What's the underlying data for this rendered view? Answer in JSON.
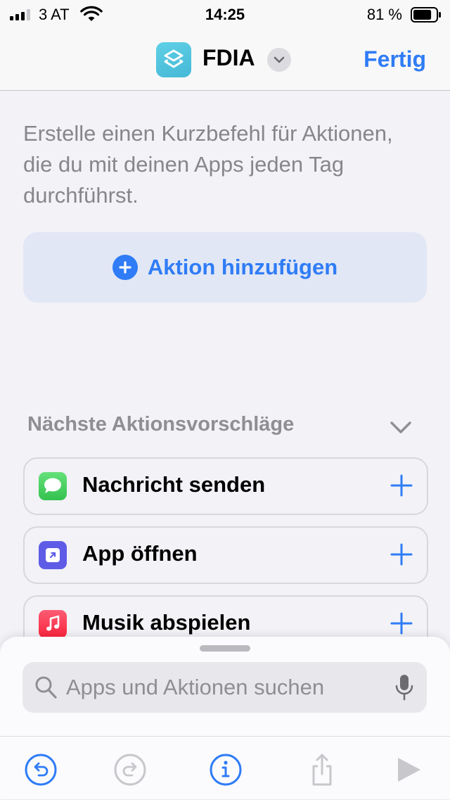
{
  "status_bar": {
    "carrier": "3 AT",
    "time": "14:25",
    "battery_percent": "81 %",
    "battery_level": 0.81
  },
  "nav": {
    "app_icon": "shortcuts-layers-icon",
    "title": "FDIA",
    "done_label": "Fertig"
  },
  "intro_text": "Erstelle einen Kurzbefehl für Aktionen, die du mit deinen Apps jeden Tag durchführst.",
  "add_action_label": "Aktion hinzufügen",
  "suggestions": {
    "header": "Nächste Aktionsvorschläge",
    "items": [
      {
        "label": "Nachricht senden",
        "icon": "messages-icon",
        "color": "#34c759"
      },
      {
        "label": "App öffnen",
        "icon": "open-app-icon",
        "color": "#5e5ce6"
      },
      {
        "label": "Musik abspielen",
        "icon": "music-icon",
        "color": "#fc3c44"
      }
    ]
  },
  "search": {
    "placeholder": "Apps und Aktionen suchen",
    "value": ""
  },
  "toolbar": {
    "items": [
      "undo-icon",
      "redo-icon",
      "info-icon",
      "share-icon",
      "play-icon"
    ]
  },
  "colors": {
    "accent": "#2f7cf6",
    "background": "#f2f2f7",
    "secondary_text": "#86868b"
  }
}
